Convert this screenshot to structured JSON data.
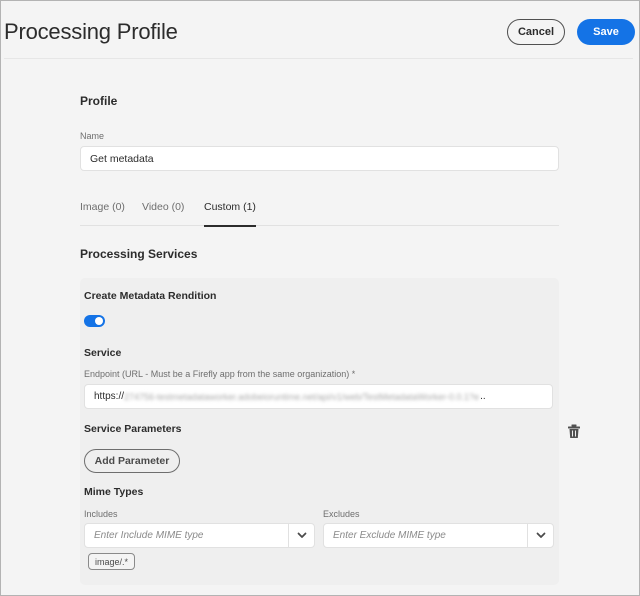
{
  "header": {
    "title": "Processing Profile",
    "cancel_label": "Cancel",
    "save_label": "Save"
  },
  "profile": {
    "section_title": "Profile",
    "name_label": "Name",
    "name_value": "Get metadata"
  },
  "tabs": [
    {
      "label": "Image (0)",
      "active": false
    },
    {
      "label": "Video (0)",
      "active": false
    },
    {
      "label": "Custom (1)",
      "active": true
    }
  ],
  "processing_services": {
    "section_title": "Processing Services",
    "rendition": {
      "title": "Create Metadata Rendition",
      "enabled": true,
      "service_title": "Service",
      "endpoint_label": "Endpoint (URL - Must be a Firefly app from the same organization) *",
      "endpoint_prefix": "https://",
      "endpoint_obscured": "274756-testmetadataworker.adobeioruntime.net/api/v1/web/TestMetadataWorker-0.0.1?e",
      "endpoint_ellipsis": "..",
      "service_parameters_title": "Service Parameters",
      "add_parameter_label": "Add Parameter",
      "mime_types_title": "Mime Types",
      "includes_label": "Includes",
      "includes_placeholder": "Enter Include MIME type",
      "includes_tags": [
        "image/.*"
      ],
      "excludes_label": "Excludes",
      "excludes_placeholder": "Enter Exclude MIME type"
    }
  },
  "icons": {
    "toggle": "toggle-switch-on",
    "dropdown": "chevron-down-icon",
    "delete": "trash-icon"
  },
  "colors": {
    "accent": "#1473e6",
    "background": "#f4f4f4",
    "card": "#efefef",
    "text": "#2c2c2c"
  }
}
